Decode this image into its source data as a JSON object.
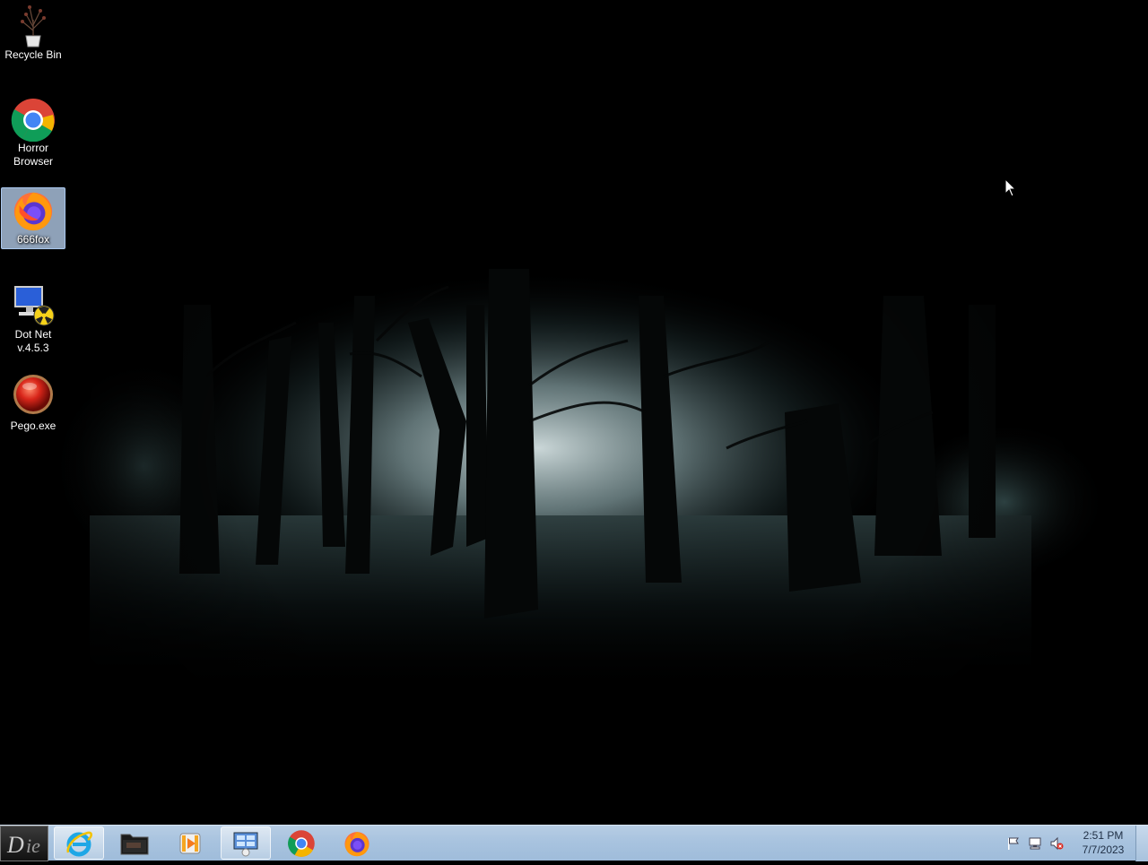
{
  "desktop": {
    "icons": [
      {
        "label": "Recycle Bin",
        "icon": "recycle-bin-icon"
      },
      {
        "label": "Horror Browser",
        "icon": "chrome-icon"
      },
      {
        "label": "666fox",
        "icon": "firefox-icon",
        "selected": true
      },
      {
        "label": "Dot Net v.4.5.3",
        "icon": "installer-icon"
      },
      {
        "label": "Pego.exe",
        "icon": "red-orb-icon"
      }
    ]
  },
  "taskbar": {
    "start": {
      "icon": "start-logo-icon"
    },
    "buttons": [
      {
        "name": "internet-explorer",
        "icon": "ie-icon"
      },
      {
        "name": "file-explorer",
        "icon": "folder-icon"
      },
      {
        "name": "media-player",
        "icon": "media-player-icon"
      },
      {
        "name": "control-panel",
        "icon": "control-panel-icon",
        "active": true
      },
      {
        "name": "chrome",
        "icon": "chrome-icon"
      },
      {
        "name": "firefox",
        "icon": "firefox-icon"
      }
    ],
    "tray": {
      "icons": [
        "action-center-flag-icon",
        "network-icon",
        "volume-muted-icon"
      ],
      "time": "2:51 PM",
      "date": "7/7/2023"
    }
  }
}
